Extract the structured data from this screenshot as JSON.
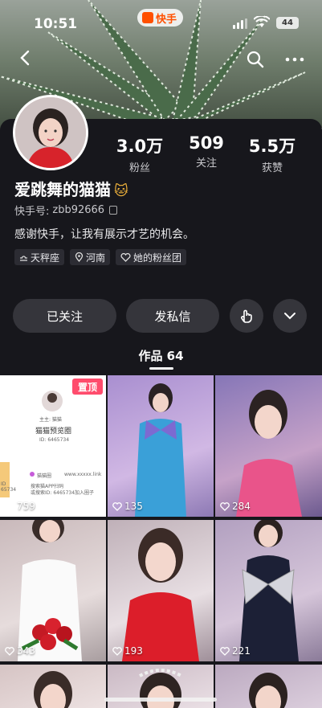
{
  "status_bar": {
    "time": "10:51",
    "battery": "44"
  },
  "app_name": "快手",
  "profile": {
    "nickname": "爱跳舞的猫猫",
    "nickname_emoji": "🐱",
    "kuaishou_id_label": "快手号:",
    "kuaishou_id": "zbb92666",
    "bio": "感谢快手，让我有展示才艺的机会。",
    "tags": [
      {
        "icon": "libra-icon",
        "text": "天秤座"
      },
      {
        "icon": "location-icon",
        "text": "河南"
      },
      {
        "icon": "fan-group-icon",
        "text": "她的粉丝团"
      }
    ],
    "stats": [
      {
        "value": "3.0万",
        "label": "粉丝"
      },
      {
        "value": "509",
        "label": "关注"
      },
      {
        "value": "5.5万",
        "label": "获赞"
      }
    ]
  },
  "actions": {
    "followed": "已关注",
    "message": "发私信"
  },
  "works_tab": "作品 64",
  "grid": [
    {
      "likes": "759",
      "pinned_label": "置顶",
      "poster": {
        "host": "主主: 猫猫",
        "title": "猫猫预览圈",
        "id_line": "ID: 6465734",
        "brand": "猫猫圈",
        "url": "www.xxxxx.link",
        "line1": "搜索猫APP扫码",
        "line2": "或搜索ID: 6465734加入圈子",
        "side": "ID 65734"
      }
    },
    {
      "likes": "135"
    },
    {
      "likes": "284"
    },
    {
      "likes": "343"
    },
    {
      "likes": "193"
    },
    {
      "likes": "221"
    }
  ],
  "colors": {
    "background": "#17171c",
    "button": "#35353b",
    "pin": "#ff4c6d",
    "brand": "#ff5000"
  }
}
